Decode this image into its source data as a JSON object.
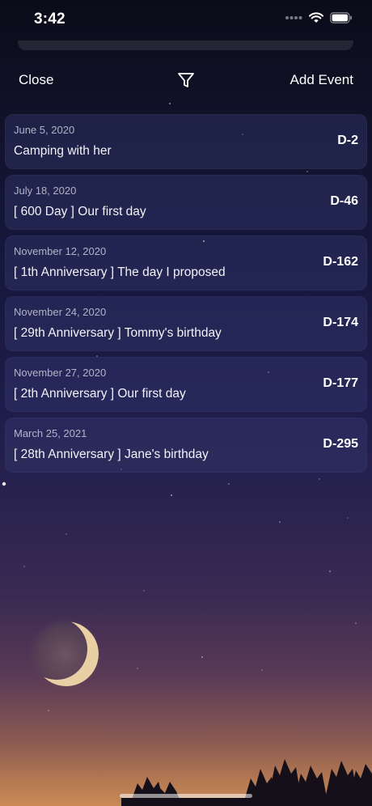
{
  "status_bar": {
    "time": "3:42"
  },
  "nav": {
    "close_label": "Close",
    "filter_icon": "filter-icon",
    "add_label": "Add Event"
  },
  "events": [
    {
      "date": "June 5, 2020",
      "title": "Camping with her",
      "dday": "D-2"
    },
    {
      "date": "July 18, 2020",
      "title": "[ 600 Day ] Our first day",
      "dday": "D-46"
    },
    {
      "date": "November 12, 2020",
      "title": "[ 1th Anniversary ] The day I proposed",
      "dday": "D-162"
    },
    {
      "date": "November 24, 2020",
      "title": "[ 29th Anniversary ] Tommy's birthday",
      "dday": "D-174"
    },
    {
      "date": "November 27, 2020",
      "title": "[ 2th Anniversary ] Our first day",
      "dday": "D-177"
    },
    {
      "date": "March 25, 2021",
      "title": "[ 28th Anniversary ] Jane's birthday",
      "dday": "D-295"
    }
  ],
  "colors": {
    "card_bg": "#343a70",
    "text_primary": "#ffffff",
    "text_secondary": "#e6e8f5"
  }
}
